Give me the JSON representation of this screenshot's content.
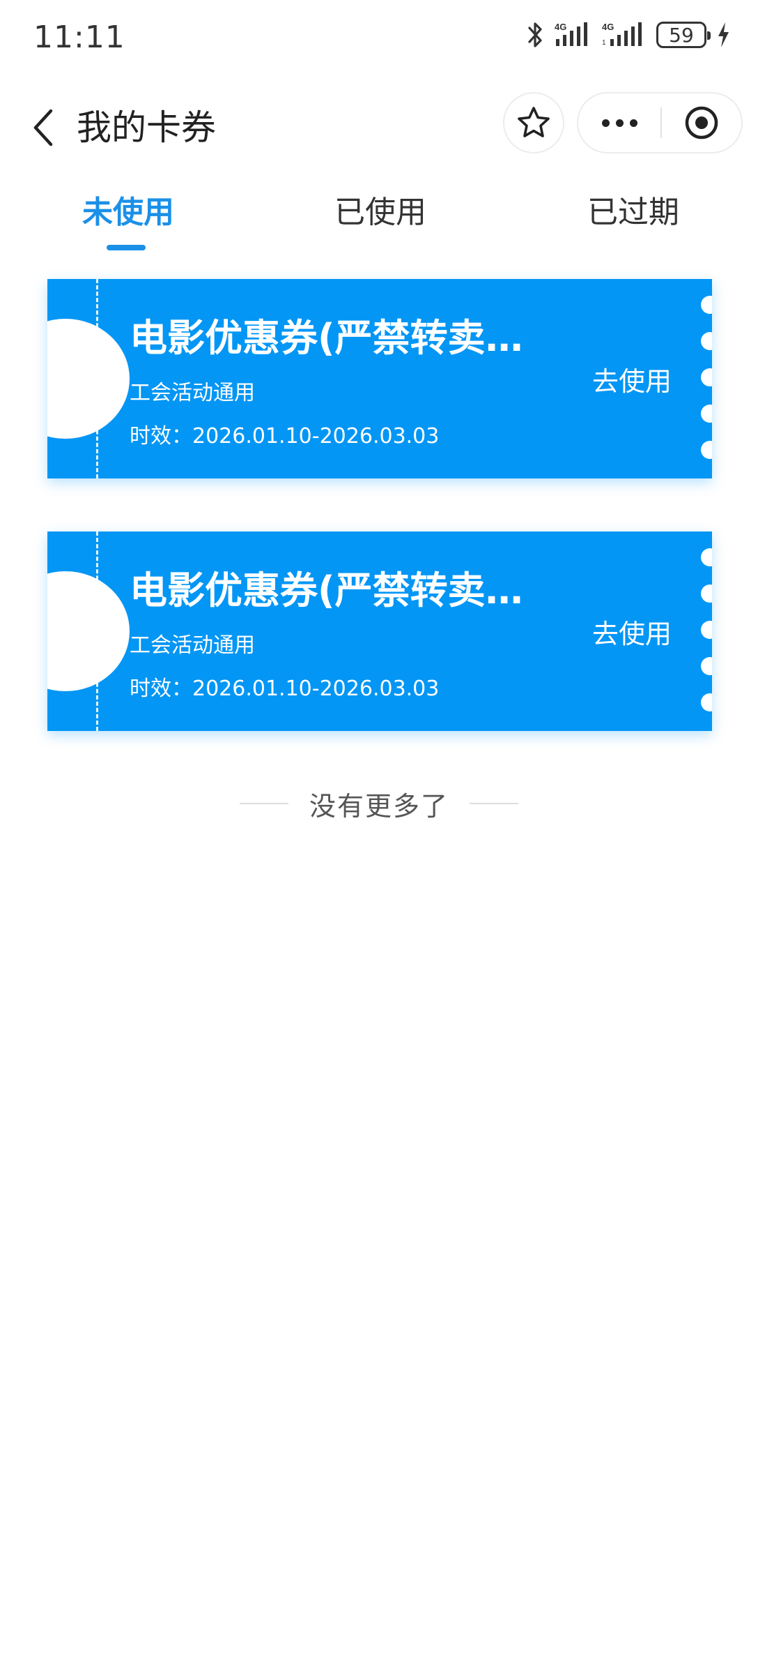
{
  "status_bar": {
    "time": "11:11",
    "battery": "59",
    "icons": [
      "bluetooth-icon",
      "signal-4g-icon",
      "signal-4g-icon",
      "battery-icon",
      "charging-icon"
    ]
  },
  "header": {
    "title": "我的卡券",
    "icons": [
      "back-arrow-icon",
      "star-icon",
      "more-dots-icon",
      "target-icon"
    ]
  },
  "tabs": [
    {
      "label": "未使用",
      "active": true
    },
    {
      "label": "已使用",
      "active": false
    },
    {
      "label": "已过期",
      "active": false
    }
  ],
  "coupons": [
    {
      "title": "电影优惠券(严禁转卖…",
      "subtitle": "工会活动通用",
      "validity": "时效：2026.01.10-2026.03.03",
      "action": "去使用"
    },
    {
      "title": "电影优惠券(严禁转卖…",
      "subtitle": "工会活动通用",
      "validity": "时效：2026.01.10-2026.03.03",
      "action": "去使用"
    }
  ],
  "footer": {
    "end_text": "没有更多了"
  },
  "colors": {
    "accent": "#1a90e8",
    "coupon_bg": "#0396f5"
  }
}
